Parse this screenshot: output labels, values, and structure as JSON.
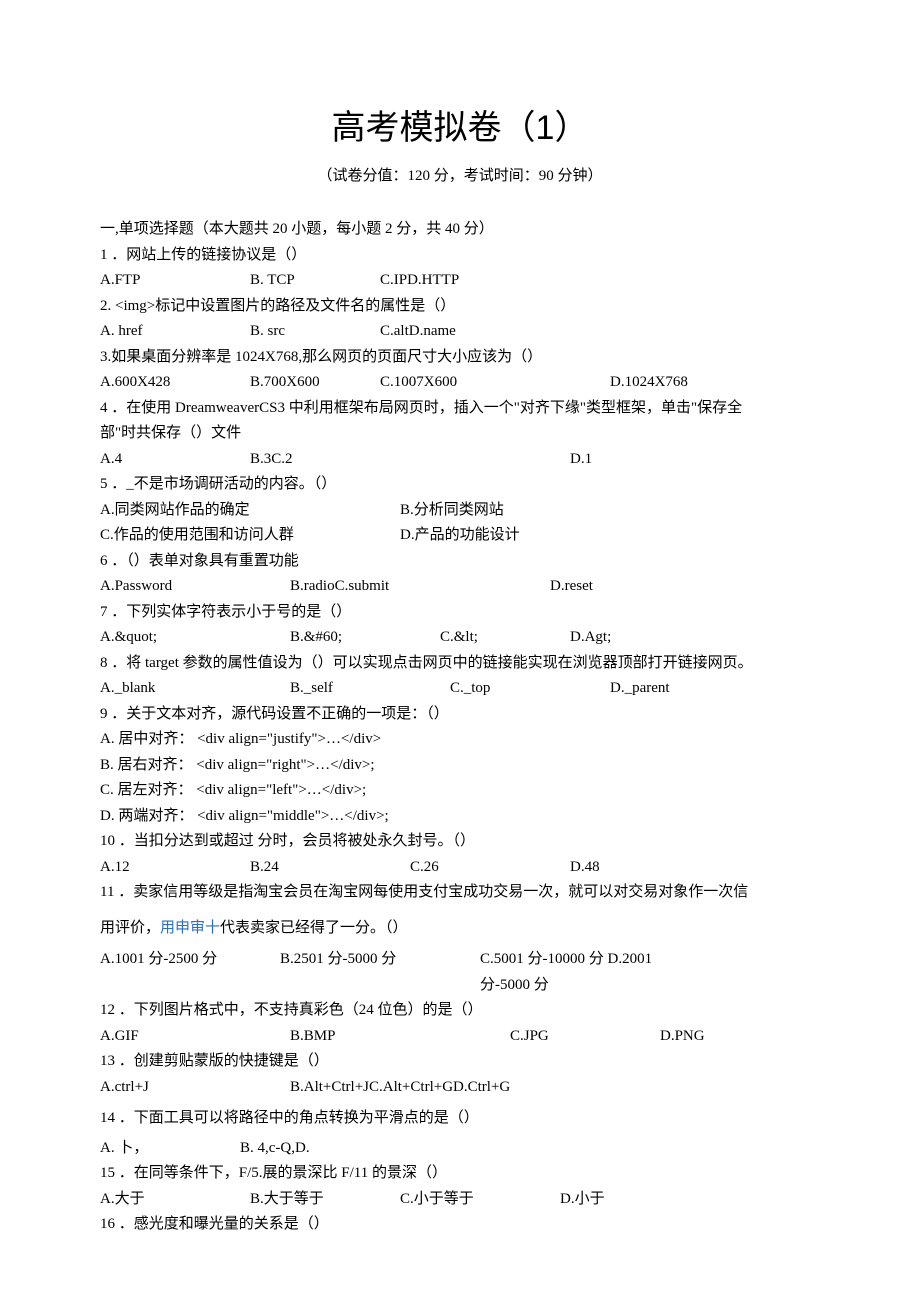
{
  "title": "高考模拟卷（1）",
  "subtitle": "（试卷分值：120 分，考试时间：90 分钟）",
  "section1_header": "一,单项选择题（本大题共 20 小题，每小题 2 分，共 40 分）",
  "q1": {
    "stem": "1 ．网站上传的链接协议是（）",
    "a": "A.FTP",
    "b": "B.  TCP",
    "c": "C.IPD.HTTP"
  },
  "q2": {
    "stem": "2.  <img>标记中设置图片的路径及文件名的属性是（）",
    "a": "A. href",
    "b": "B.  src",
    "c": "C.altD.name"
  },
  "q3": {
    "stem": "3.如果桌面分辨率是 1024X768,那么网页的页面尺寸大小应该为（）",
    "a": "A.600X428",
    "b": "B.700X600",
    "c": "C.1007X600",
    "d": "D.1024X768"
  },
  "q4": {
    "stem1": "4 ．在使用 DreamweaverCS3 中利用框架布局网页时，插入一个\"对齐下缘\"类型框架，单击\"保存全",
    "stem2": "部\"时共保存（）文件",
    "a": "A.4",
    "b": "B.3C.2",
    "d": "D.1"
  },
  "q5": {
    "stem": "5 ．_不是市场调研活动的内容。（）",
    "a": "A.同类网站作品的确定",
    "b": "B.分析同类网站",
    "c": "C.作品的使用范围和访问人群",
    "d": "D.产品的功能设计"
  },
  "q6": {
    "stem": "6 ．（）表单对象具有重置功能",
    "a": "A.Password",
    "b": "B.radioC.submit",
    "d": "D.reset"
  },
  "q7": {
    "stem": "7 ．下列实体字符表示小于号的是（）",
    "a": "A.&quot;",
    "b": "B.&#60;",
    "c": "C.&lt;",
    "d": "D.Agt;"
  },
  "q8": {
    "stem": "8 ．将 target 参数的属性值设为（）可以实现点击网页中的链接能实现在浏览器顶部打开链接网页。",
    "a": "A._blank",
    "b": "B._self",
    "c": "C._top",
    "d": "D._parent"
  },
  "q9": {
    "stem": "9 ．关于文本对齐，源代码设置不正确的一项是：（）",
    "a": "A. 居中对齐： <div     align=\"justify\">…</div>",
    "b": "B. 居右对齐： <div     align=\"right\">…</div>;",
    "c": "C. 居左对齐： <div     align=\"left\">…</div>;",
    "d": "D. 两端对齐： <div     align=\"middle\">…</div>;"
  },
  "q10": {
    "stem": "10 ．当扣分达到或超过    分时，会员将被处永久封号。（）",
    "a": "A.12",
    "b": "B.24",
    "c": "C.26",
    "d": "D.48"
  },
  "q11": {
    "stem1": "11 ．卖家信用等级是指淘宝会员在淘宝网每使用支付宝成功交易一次，就可以对交易对象作一次信",
    "stem2a": "用评价，",
    "stem2link": "用申审十",
    "stem2b": "代表卖家已经得了一分。（）",
    "a": "A.1001 分-2500 分",
    "b": "B.2501 分-5000 分",
    "c": "C.5001 分-10000 分 D.2001 分-5000 分"
  },
  "q12": {
    "stem": "12 ．下列图片格式中，不支持真彩色（24 位色）的是（）",
    "a": "A.GIF",
    "b": "B.BMP",
    "c": "C.JPG",
    "d": "D.PNG"
  },
  "q13": {
    "stem": "13 ．创建剪贴蒙版的快捷键是（）",
    "a": "A.ctrl+J",
    "b": "B.Alt+Ctrl+JC.Alt+Ctrl+GD.Ctrl+G"
  },
  "q14": {
    "stem": "14 ．下面工具可以将路径中的角点转换为平滑点的是（）",
    "a": "A.    卜，",
    "b": "B.     4,c-Q,D."
  },
  "q15": {
    "stem": "15 ．在同等条件下，F/5.展的景深比 F/11 的景深（）",
    "a": "A.大于",
    "b": "B.大于等于",
    "c": "C.小于等于",
    "d": "D.小于"
  },
  "q16": {
    "stem": "16 ．感光度和曝光量的关系是（）"
  }
}
